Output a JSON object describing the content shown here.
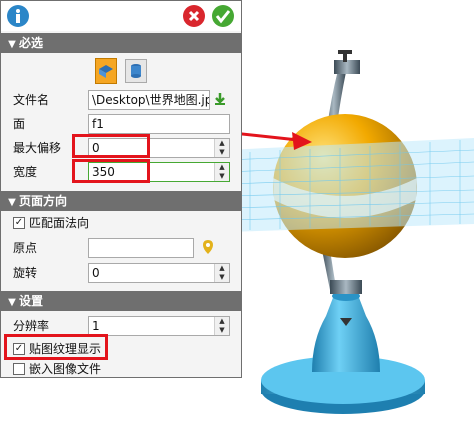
{
  "sections": {
    "required": "必选",
    "page_direction": "页面方向",
    "settings": "设置"
  },
  "fields": {
    "filename_label": "文件名",
    "filename_value": "\\Desktop\\世界地图.jpg",
    "face_label": "面",
    "face_value": "f1",
    "max_offset_label": "最大偏移",
    "max_offset_value": "0",
    "width_label": "宽度",
    "width_value": "350",
    "match_normal_label": "匹配面法向",
    "origin_label": "原点",
    "rotation_label": "旋转",
    "rotation_value": "0",
    "resolution_label": "分辨率",
    "resolution_value": "1",
    "texture_display_label": "贴图纹理显示",
    "embed_image_label": "嵌入图像文件"
  },
  "checks": {
    "match_normal": true,
    "texture_display": true,
    "embed_image": false
  },
  "colors": {
    "header": "#6f6f6f",
    "highlight": "#e3141c",
    "sphere": "#f2a900",
    "base": "#3aaad8",
    "plane": "#7fd3f2",
    "info_btn": "#2b86c8",
    "cancel_btn": "#d9262d",
    "ok_btn": "#46a833"
  },
  "icons": [
    "info-icon",
    "cancel-icon",
    "ok-icon",
    "cube-mode-icon",
    "cylinder-mode-icon",
    "download-icon",
    "pick-point-icon"
  ]
}
